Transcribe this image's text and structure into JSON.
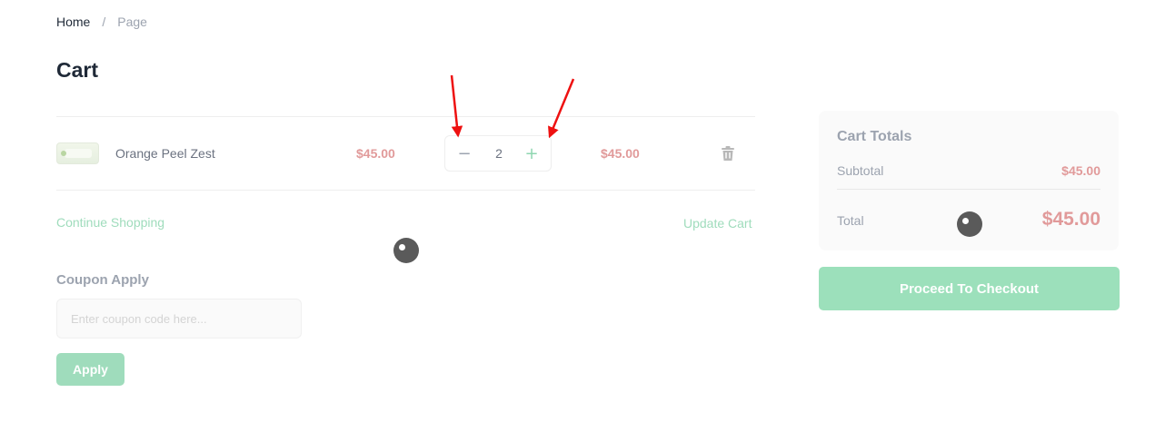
{
  "breadcrumb": {
    "home": "Home",
    "separator": "/",
    "current": "Page"
  },
  "page_title": "Cart",
  "cart_item": {
    "name": "Orange Peel Zest",
    "price": "$45.00",
    "quantity": "2",
    "line_total": "$45.00",
    "minus_label": "−",
    "plus_label": "+",
    "delete_icon": "trash-icon"
  },
  "links": {
    "continue_shopping": "Continue Shopping",
    "update_cart": "Update Cart"
  },
  "coupon": {
    "title": "Coupon Apply",
    "placeholder": "Enter coupon code here...",
    "apply_label": "Apply"
  },
  "totals": {
    "title": "Cart Totals",
    "subtotal_label": "Subtotal",
    "subtotal_value": "$45.00",
    "total_label": "Total",
    "total_value": "$45.00"
  },
  "checkout_label": "Proceed To Checkout",
  "colors": {
    "accent_green": "#9ce0bb",
    "price_red": "#e19a9a",
    "annotation_red": "#ee1111"
  }
}
